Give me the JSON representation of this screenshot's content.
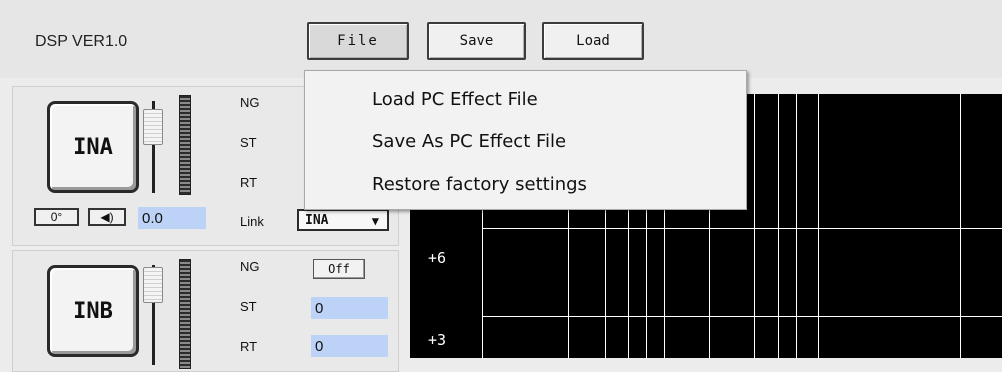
{
  "header": {
    "title": "DSP VER1.0",
    "buttons": {
      "file": "File",
      "save": "Save",
      "load": "Load"
    }
  },
  "file_menu": {
    "items": [
      "Load PC Effect File",
      "Save As PC Effect File",
      "Restore factory settings"
    ]
  },
  "channels": [
    {
      "name": "INA",
      "phase": "0°",
      "speaker": "◀)",
      "gain": "0.0",
      "labels": {
        "ng": "NG",
        "st": "ST",
        "rt": "RT",
        "link": "Link"
      },
      "link_value": "INA",
      "link_arrow": "▼"
    },
    {
      "name": "INB",
      "labels": {
        "ng": "NG",
        "st": "ST",
        "rt": "RT"
      },
      "ng_value": "Off",
      "st_value": "0",
      "rt_value": "0"
    }
  ],
  "graph": {
    "y_ticks": [
      "+6",
      "+3"
    ]
  },
  "colors": {
    "value_box_bg": "#bcd3f7",
    "graph_bg": "#000000",
    "grid": "#ffffff"
  }
}
